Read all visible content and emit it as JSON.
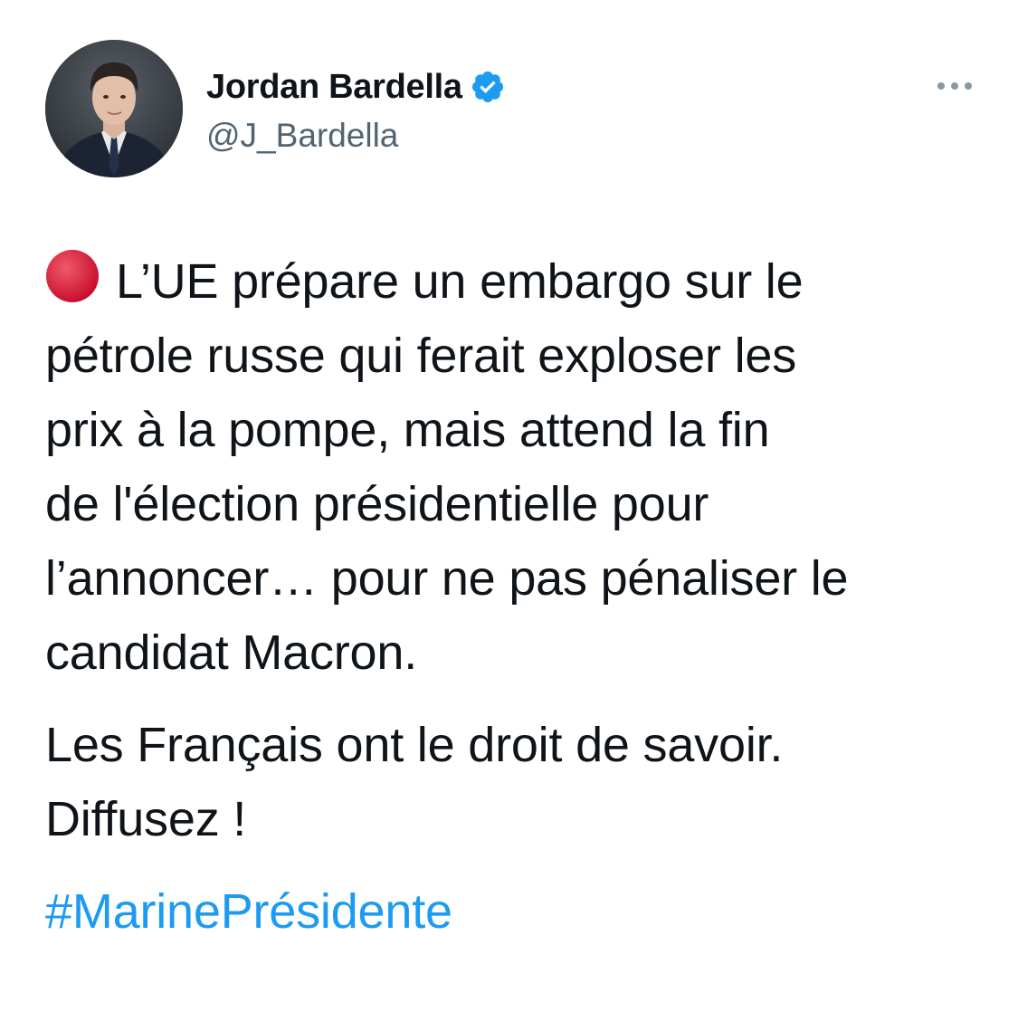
{
  "author": {
    "display_name": "Jordan Bardella",
    "handle": "@J_Bardella",
    "verified_icon": "verified-badge-icon",
    "verified_color": "#1d9bf0"
  },
  "menu": {
    "more_icon": "more-horizontal-icon"
  },
  "tweet": {
    "emoji_icon": "red-circle-icon",
    "emoji_color": "#dd2e44",
    "lines_p1": [
      "L’UE prépare un embargo sur le",
      "pétrole russe qui ferait exploser les",
      "prix à la pompe, mais attend la fin",
      "de l'élection présidentielle pour",
      "l’annoncer… pour ne pas pénaliser le",
      "candidat Macron."
    ],
    "lines_p2": [
      "Les Français ont le droit de savoir.",
      "Diffusez !"
    ],
    "hashtag": "#MarinePrésidente",
    "hashtag_color": "#1d9bf0"
  }
}
